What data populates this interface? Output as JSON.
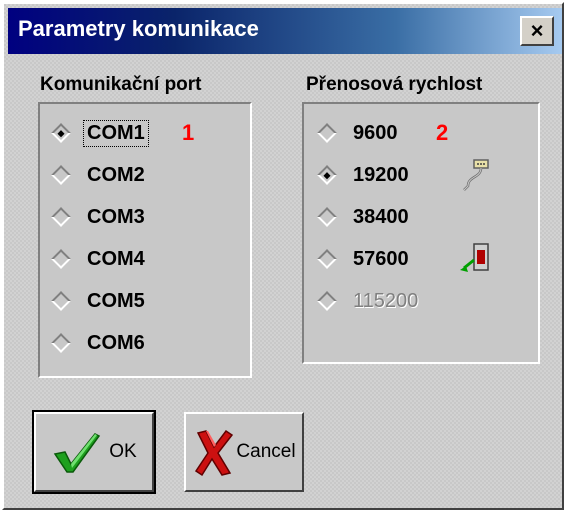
{
  "window": {
    "title": "Parametry komunikace",
    "close_glyph": "×"
  },
  "port_group": {
    "title": "Komunikační port",
    "selected": "COM1",
    "annotation": "1",
    "options": [
      "COM1",
      "COM2",
      "COM3",
      "COM4",
      "COM5",
      "COM6"
    ]
  },
  "speed_group": {
    "title": "Přenosová rychlost",
    "selected": "19200",
    "annotation": "2",
    "disabled": [
      "115200"
    ],
    "options": [
      "9600",
      "19200",
      "38400",
      "57600",
      "115200"
    ],
    "icons": {
      "19200": "serial-cable-icon",
      "57600": "device-connector-icon"
    }
  },
  "buttons": {
    "ok_label": "OK",
    "cancel_label": "Cancel",
    "ok_icon": "green-checkmark-icon",
    "cancel_icon": "red-x-icon"
  },
  "colors": {
    "annotation": "#ff0000",
    "titlebar_start": "#000080",
    "titlebar_end": "#a6caf0"
  }
}
